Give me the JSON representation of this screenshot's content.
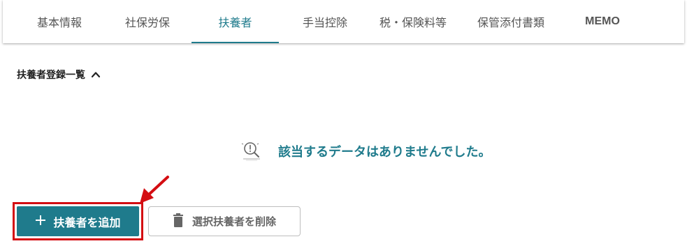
{
  "tabs": [
    {
      "label": "基本情報"
    },
    {
      "label": "社保労保"
    },
    {
      "label": "扶養者"
    },
    {
      "label": "手当控除"
    },
    {
      "label": "税・保険料等"
    },
    {
      "label": "保管添付書類"
    },
    {
      "label": "MEMO"
    }
  ],
  "active_tab": "扶養者",
  "section": {
    "title": "扶養者登録一覧",
    "collapse_icon": "chevron-up-icon"
  },
  "empty_state": {
    "icon": "search-alert-icon",
    "message": "該当するデータはありませんでした。"
  },
  "actions": {
    "add_label": "扶養者を追加",
    "add_icon": "plus-icon",
    "delete_label": "選択扶養者を削除",
    "delete_icon": "trash-icon"
  },
  "colors": {
    "accent": "#1f7b8c",
    "highlight": "#d40d12"
  }
}
